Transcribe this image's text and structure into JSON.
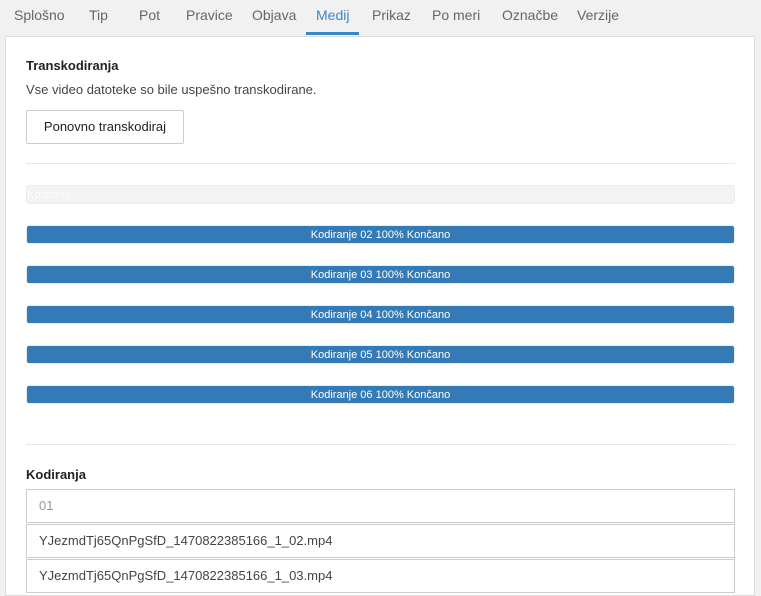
{
  "tabs": [
    {
      "label": "Splošno",
      "active": false
    },
    {
      "label": "Tip",
      "active": false
    },
    {
      "label": "Pot",
      "active": false
    },
    {
      "label": "Pravice",
      "active": false
    },
    {
      "label": "Objava",
      "active": false
    },
    {
      "label": "Medij",
      "active": true
    },
    {
      "label": "Prikaz",
      "active": false
    },
    {
      "label": "Po meri",
      "active": false
    },
    {
      "label": "Označbe",
      "active": false
    },
    {
      "label": "Verzije",
      "active": false
    }
  ],
  "transcoding": {
    "title": "Transkodiranja",
    "description": "Vse video datoteke so bile uspešno transkodirane.",
    "retranscode_button": "Ponovno transkodiraj",
    "progress_bars": [
      {
        "label": "Kodiranje",
        "percent": 0
      },
      {
        "label": "Kodiranje 02 100% Končano",
        "percent": 100
      },
      {
        "label": "Kodiranje 03 100% Končano",
        "percent": 100
      },
      {
        "label": "Kodiranje 04 100% Končano",
        "percent": 100
      },
      {
        "label": "Kodiranje 05 100% Končano",
        "percent": 100
      },
      {
        "label": "Kodiranje 06 100% Končano",
        "percent": 100
      }
    ]
  },
  "encodings": {
    "title": "Kodiranja",
    "fields": [
      {
        "value": "",
        "placeholder": "01"
      },
      {
        "value": "YJezmdTj65QnPgSfD_1470822385166_1_02.mp4",
        "placeholder": ""
      },
      {
        "value": "YJezmdTj65QnPgSfD_1470822385166_1_03.mp4",
        "placeholder": ""
      }
    ]
  },
  "colors": {
    "accent": "#3a87c8",
    "progress": "#337ab7"
  }
}
